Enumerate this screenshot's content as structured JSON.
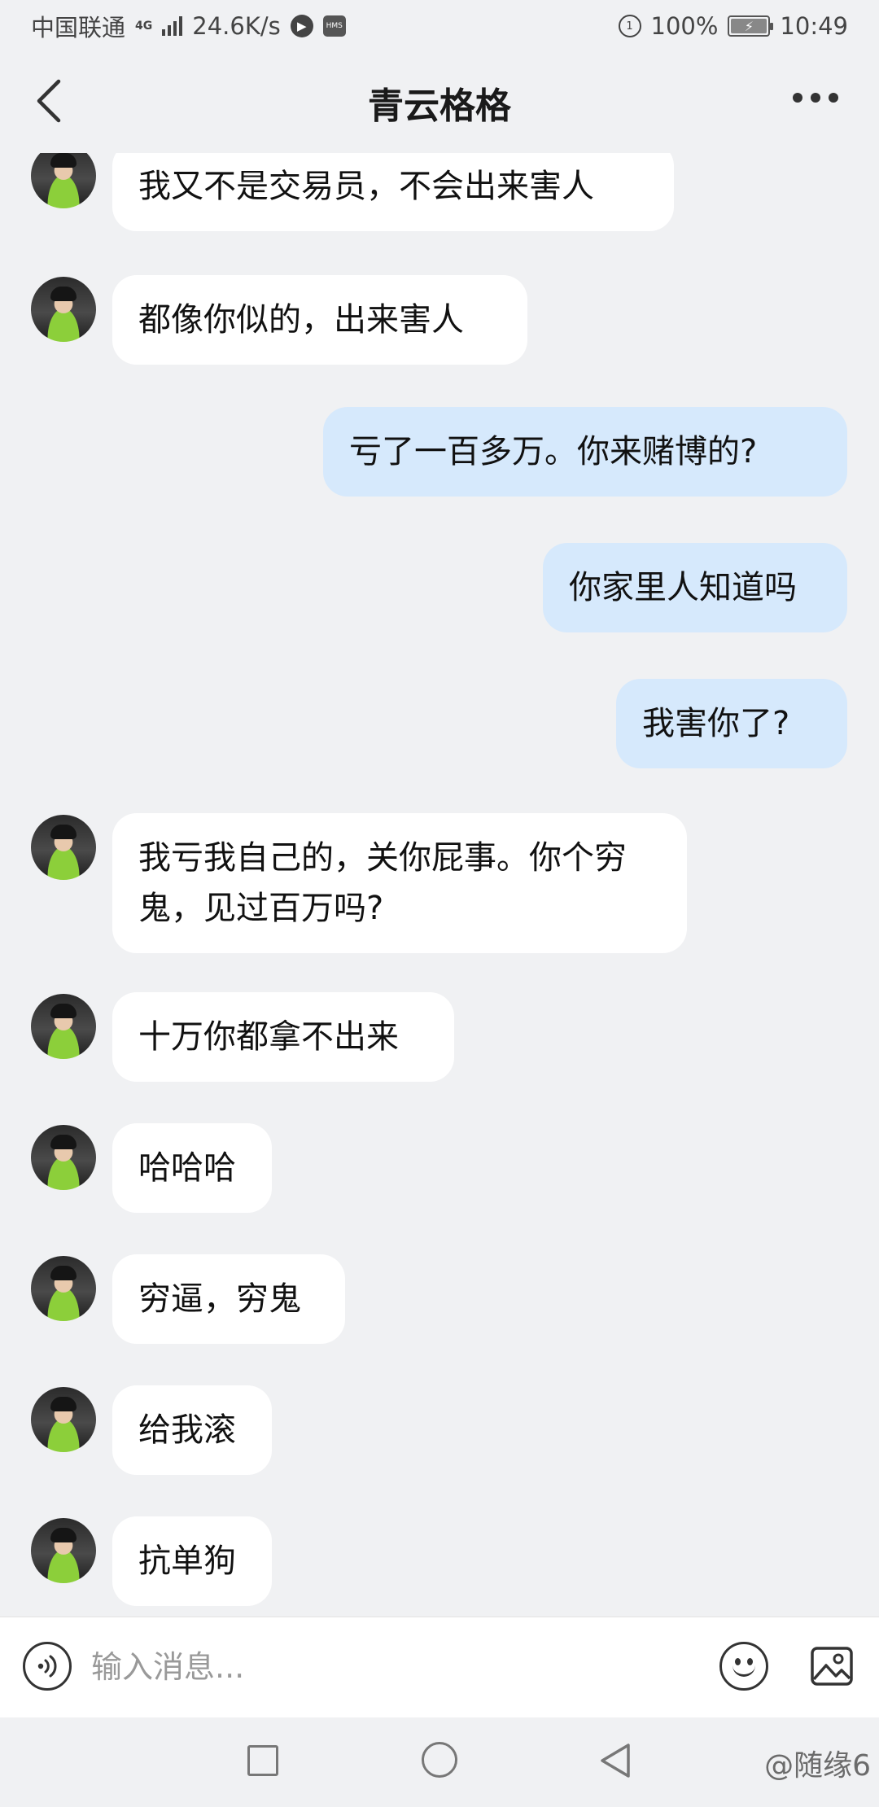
{
  "status_bar": {
    "carrier": "中国联通",
    "network_type": "4G",
    "speed": "24.6K/s",
    "battery": "100%",
    "time": "10:49",
    "icons": [
      "signal-icon",
      "play-icon",
      "hms-icon",
      "data-saver-icon",
      "battery-charging-icon"
    ]
  },
  "header": {
    "title": "青云格格",
    "back_icon": "chevron-left-icon",
    "more_icon": "more-dots-icon"
  },
  "messages": [
    {
      "sender": "other",
      "text": "我又不是交易员，不会出来害人"
    },
    {
      "sender": "other",
      "text": "都像你似的，出来害人"
    },
    {
      "sender": "me",
      "text": "亏了一百多万。你来赌博的?"
    },
    {
      "sender": "me",
      "text": "你家里人知道吗"
    },
    {
      "sender": "me",
      "text": "我害你了?"
    },
    {
      "sender": "other",
      "text": "我亏我自己的，关你屁事。你个穷鬼，见过百万吗?"
    },
    {
      "sender": "other",
      "text": "十万你都拿不出来"
    },
    {
      "sender": "other",
      "text": "哈哈哈"
    },
    {
      "sender": "other",
      "text": "穷逼，穷鬼"
    },
    {
      "sender": "other",
      "text": "给我滚"
    },
    {
      "sender": "other",
      "text": "抗单狗"
    }
  ],
  "input_bar": {
    "placeholder": "输入消息...",
    "value": "",
    "left_icon": "voice-icon",
    "right_icons": [
      "emoji-icon",
      "image-icon"
    ]
  },
  "system_nav": {
    "icons": [
      "recent-apps-icon",
      "home-icon",
      "back-triangle-icon"
    ]
  },
  "watermark": "@随缘6"
}
